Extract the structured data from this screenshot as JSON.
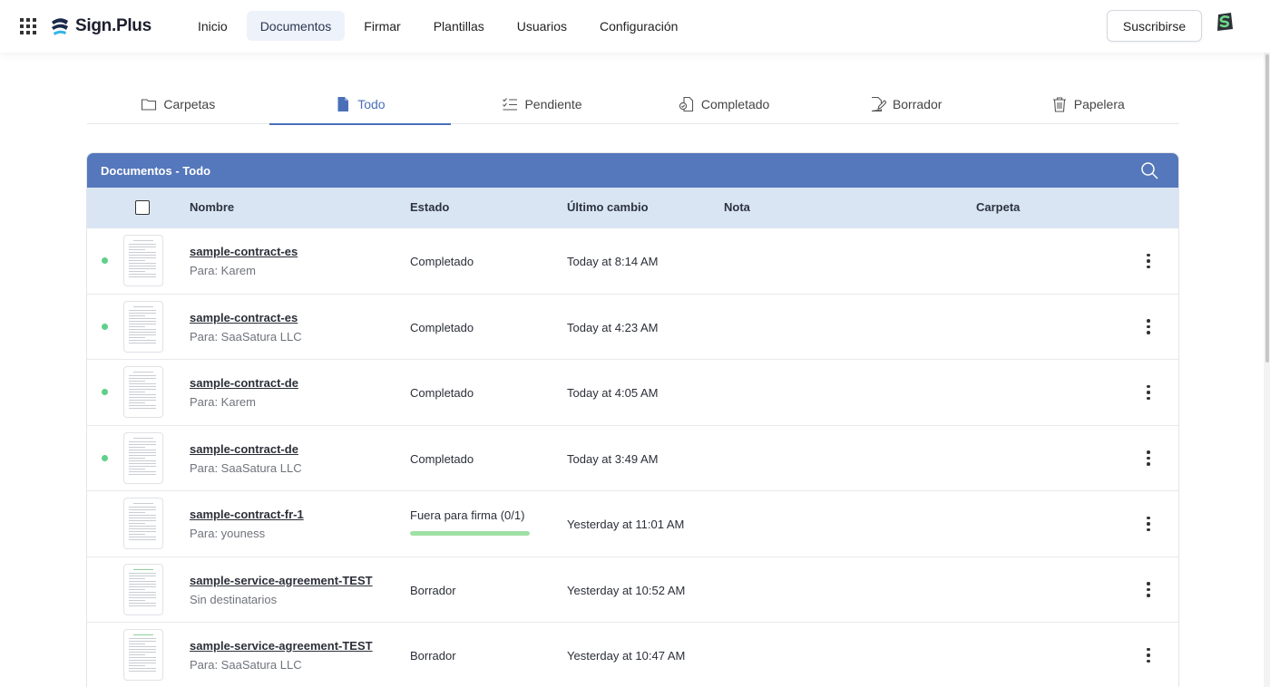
{
  "brand": {
    "name": "Sign.Plus"
  },
  "nav": {
    "items": [
      {
        "label": "Inicio"
      },
      {
        "label": "Documentos",
        "active": true
      },
      {
        "label": "Firmar"
      },
      {
        "label": "Plantillas"
      },
      {
        "label": "Usuarios"
      },
      {
        "label": "Configuración"
      }
    ],
    "subscribe_label": "Suscribirse"
  },
  "tabs": [
    {
      "label": "Carpetas",
      "icon": "folder-icon"
    },
    {
      "label": "Todo",
      "icon": "document-icon",
      "active": true
    },
    {
      "label": "Pendiente",
      "icon": "checklist-icon"
    },
    {
      "label": "Completado",
      "icon": "completed-document-icon"
    },
    {
      "label": "Borrador",
      "icon": "draft-pen-icon"
    },
    {
      "label": "Papelera",
      "icon": "trash-icon"
    }
  ],
  "table": {
    "title": "Documentos - Todo",
    "columns": {
      "name": "Nombre",
      "status": "Estado",
      "changed": "Último cambio",
      "note": "Nota",
      "folder": "Carpeta"
    },
    "rows": [
      {
        "name": "sample-contract-es",
        "to": "Para: Karem",
        "status": "Completado",
        "changed": "Today at 8:14 AM",
        "completed_dot": true
      },
      {
        "name": "sample-contract-es",
        "to": "Para: SaaSatura LLC",
        "status": "Completado",
        "changed": "Today at 4:23 AM",
        "completed_dot": true
      },
      {
        "name": "sample-contract-de",
        "to": "Para: Karem",
        "status": "Completado",
        "changed": "Today at 4:05 AM",
        "completed_dot": true
      },
      {
        "name": "sample-contract-de",
        "to": "Para: SaaSatura LLC",
        "status": "Completado",
        "changed": "Today at 3:49 AM",
        "completed_dot": true
      },
      {
        "name": "sample-contract-fr-1",
        "to": "Para: youness",
        "status": "Fuera para firma (0/1)",
        "changed": "Yesterday at 11:01 AM",
        "progress": 1.0
      },
      {
        "name": "sample-service-agreement-TEST",
        "to": "Sin destinatarios",
        "status": "Borrador",
        "changed": "Yesterday at 10:52 AM",
        "green_thumb": true
      },
      {
        "name": "sample-service-agreement-TEST",
        "to": "Para: SaaSatura LLC",
        "status": "Borrador",
        "changed": "Yesterday at 10:47 AM",
        "green_thumb": true
      }
    ]
  },
  "colors": {
    "accent": "#4a6fb8",
    "header_bar": "#5577bb",
    "table_head": "#d9e5f2",
    "completed_dot": "#5ed08a",
    "progress": "#9fe0a5"
  }
}
